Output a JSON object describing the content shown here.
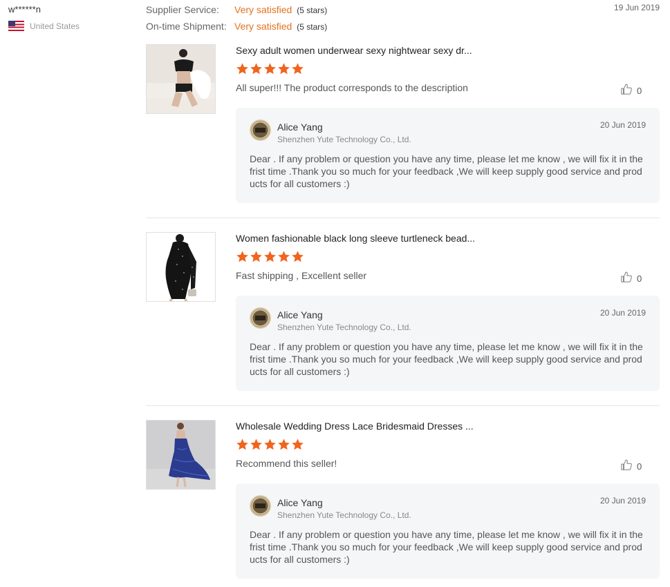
{
  "buyer": {
    "name": "w******n",
    "country": "United States",
    "flag_icon": "us-flag-icon"
  },
  "ratings": [
    {
      "label": "Supplier Service:",
      "value": "Very satisfied",
      "stars": "(5 stars)"
    },
    {
      "label": "On-time Shipment:",
      "value": "Very satisfied",
      "stars": "(5 stars)"
    }
  ],
  "review_date": "19 Jun 2019",
  "colors": {
    "accent": "#e5711c",
    "star": "#f0641e",
    "reply_bg": "#f5f6f8"
  },
  "items": [
    {
      "title": "Sexy adult women underwear sexy nightwear sexy dr...",
      "rating": 5,
      "review": "All super!!! The product corresponds to the description",
      "likes": "0",
      "reply": {
        "name": "Alice Yang",
        "company": "Shenzhen Yute Technology Co., Ltd.",
        "date": "20 Jun 2019",
        "text": "Dear . If any problem or question you have any time, please let me know ,  we will fix it in the frist time .Thank you so much for your feedback  ,We will keep supply good service and products for all customers :)"
      }
    },
    {
      "title": "Women fashionable black long sleeve turtleneck bead...",
      "rating": 5,
      "review": "Fast shipping ,   Excellent seller",
      "likes": "0",
      "reply": {
        "name": "Alice Yang",
        "company": "Shenzhen Yute Technology Co., Ltd.",
        "date": "20 Jun 2019",
        "text": "Dear . If any problem or question you have any time, please let me know ,  we will fix it in the frist time .Thank you so much for your feedback  ,We will keep supply good service and products for all customers :)"
      }
    },
    {
      "title": "Wholesale Wedding Dress Lace Bridesmaid Dresses ...",
      "rating": 5,
      "review": "Recommend this seller!",
      "likes": "0",
      "reply": {
        "name": "Alice Yang",
        "company": "Shenzhen Yute Technology Co., Ltd.",
        "date": "20 Jun 2019",
        "text": "Dear . If any problem or question you have any time, please let me know ,  we will fix it in the frist time .Thank you so much for your feedback  ,We will keep supply good service and products for all customers :)"
      }
    }
  ]
}
